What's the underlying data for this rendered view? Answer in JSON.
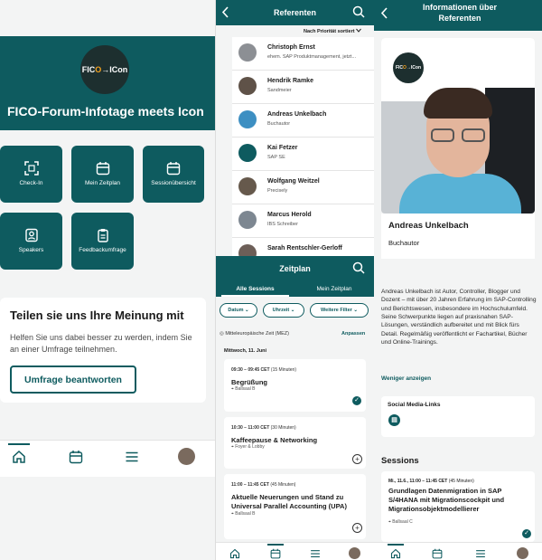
{
  "home": {
    "event_title": "FICO-Forum-Infotage meets Icon",
    "logo_text_left": "FIC",
    "logo_text_o": "O",
    "logo_text_right": "→ICon",
    "tiles": [
      {
        "label": "Check-In",
        "icon": "qr-scan-icon"
      },
      {
        "label": "Mein Zeitplan",
        "icon": "calendar-icon"
      },
      {
        "label": "Sessionübersicht",
        "icon": "calendar-list-icon"
      },
      {
        "label": "Speakers",
        "icon": "speaker-badge-icon"
      },
      {
        "label": "Feedbackumfrage",
        "icon": "clipboard-icon"
      }
    ],
    "feedback_card": {
      "heading": "Teilen sie uns Ihre Meinung mit",
      "text": "Helfen Sie uns dabei besser zu werden, indem Sie an einer Umfrage teilnehmen.",
      "button": "Umfrage beantworten"
    },
    "nav": [
      "home-icon",
      "calendar-icon",
      "menu-icon",
      "avatar"
    ]
  },
  "referenten": {
    "title": "Referenten",
    "sort_label": "Nach Priorität sortiert",
    "people": [
      {
        "name": "Christoph Ernst",
        "role": "ehem. SAP Produktmanagement, jetzt..."
      },
      {
        "name": "Hendrik Ramke",
        "role": "Sandmeier"
      },
      {
        "name": "Andreas Unkelbach",
        "role": "Buchautor"
      },
      {
        "name": "Kai Fetzer",
        "role": "SAP SE"
      },
      {
        "name": "Wolfgang Weitzel",
        "role": "Precisely"
      },
      {
        "name": "Marcus Herold",
        "role": "IBS Schreiber"
      },
      {
        "name": "Sarah Rentschler-Gerloff",
        "role": ""
      }
    ]
  },
  "zeitplan": {
    "title": "Zeitplan",
    "tabs": [
      "Alle Sessions",
      "Mein Zeitplan"
    ],
    "filters": [
      "Datum",
      "Uhrzeit",
      "Weitere Filter"
    ],
    "timezone": "Mitteleuropäische Zeit (MEZ)",
    "adjust": "Anpassen",
    "day": "Mittwoch, 11. Juni",
    "sessions": [
      {
        "time": "09:30 – 09:45 CET",
        "duration": "(15 Minuten)",
        "title": "Begrüßung",
        "room": "Ballsaal B"
      },
      {
        "time": "10:30 – 11:00 CET",
        "duration": "(30 Minuten)",
        "title": "Kaffeepause & Networking",
        "room": "Foyer & Lobby"
      },
      {
        "time": "11:00 – 11:45 CET",
        "duration": "(45 Minuten)",
        "title": "Aktuelle Neuerungen und Stand zu Universal Parallel Accounting (UPA)",
        "room": "Ballsaal B"
      }
    ]
  },
  "detail": {
    "title": "Informationen über Referenten",
    "name": "Andreas Unkelbach",
    "role": "Buchautor",
    "bio": "Andreas Unkelbach ist Autor, Controller, Blogger und Dozent – mit über 20 Jahren Erfahrung im SAP-Controlling und Berichtswesen, insbesondere im Hochschulumfeld. Seine Schwerpunkte liegen auf praxisnahen SAP-Lösungen, verständlich aufbereitet und mit Blick fürs Detail. Regelmäßig veröffentlicht er Fachartikel, Bücher und Online-Trainings.",
    "more": "Weniger anzeigen",
    "social_heading": "Social Media-Links",
    "sessions_heading": "Sessions",
    "session": {
      "time": "Mi., 11.6., 11:00 – 11:45 CET",
      "duration": "(45 Minuten)",
      "title": "Grundlagen Datenmigration in SAP S/4HANA mit Migrationscockpit und Migrationsobjektmodellierer",
      "room": "Ballsaal C"
    }
  },
  "colors": {
    "primary": "#0e5b5f",
    "background": "#f3f4f4"
  }
}
